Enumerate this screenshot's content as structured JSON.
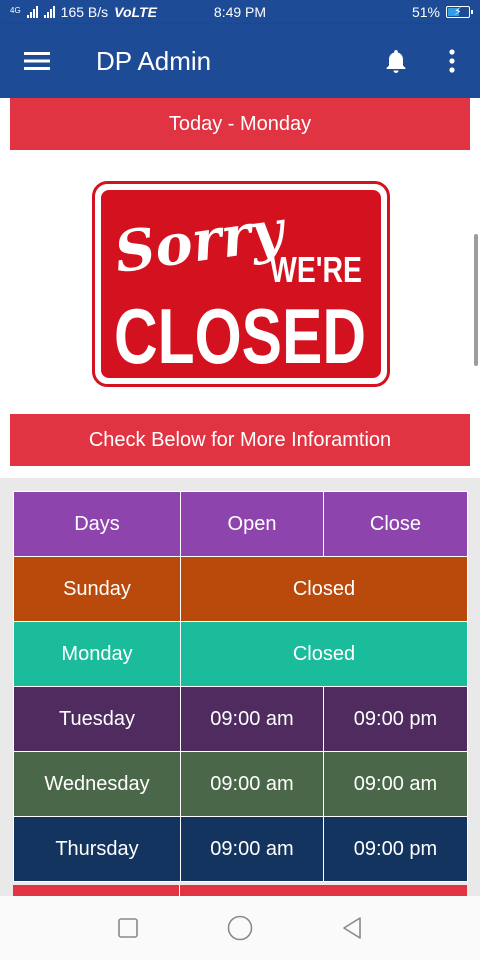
{
  "status_bar": {
    "network_small": "4G",
    "network_speed": "165 B/s",
    "volte": "VoLTE",
    "time": "8:49 PM",
    "battery": "51%",
    "battery_level": 0.51
  },
  "app_bar": {
    "title": "DP Admin",
    "menu_icon": "hamburger-menu-icon",
    "notifications_icon": "bell-icon",
    "overflow_icon": "more-vertical-icon"
  },
  "banner": {
    "today": "Today - Monday",
    "more_info": "Check Below for More Inforamtion"
  },
  "sign": {
    "sorry": "Sorry",
    "were": "WE'RE",
    "closed": "CLOSED"
  },
  "hours": {
    "headers": {
      "day": "Days",
      "open": "Open",
      "close": "Close",
      "color": "#8e44ad"
    },
    "rows": [
      {
        "day": "Sunday",
        "status": "Closed",
        "color": "#b94a0c"
      },
      {
        "day": "Monday",
        "status": "Closed",
        "color": "#1bbc9b"
      },
      {
        "day": "Tuesday",
        "open": "09:00 am",
        "close": "09:00 pm",
        "color": "#4f2b5f"
      },
      {
        "day": "Wednesday",
        "open": "09:00 am",
        "close": "09:00 am",
        "color": "#4a6749"
      },
      {
        "day": "Thursday",
        "open": "09:00 am",
        "close": "09:00 pm",
        "color": "#13345e"
      }
    ],
    "partial_row_color": "#e03442"
  },
  "colors": {
    "primary": "#1e4b96",
    "banner": "#e03442",
    "sign_red": "#d4121f"
  }
}
